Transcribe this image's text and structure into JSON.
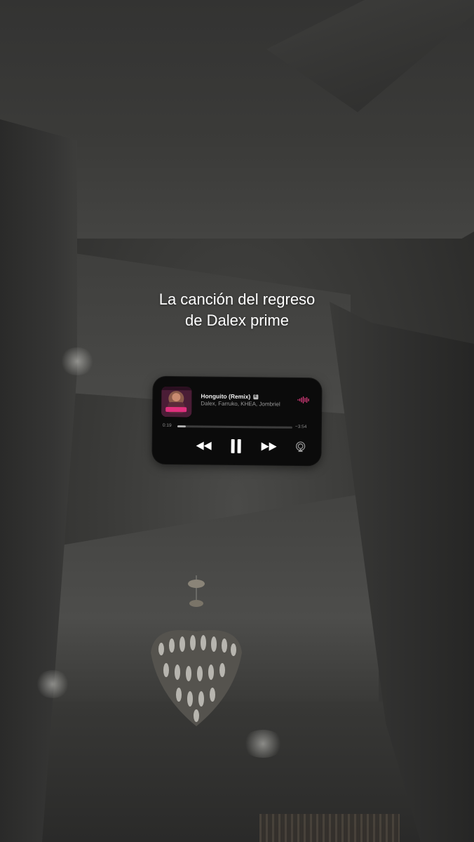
{
  "caption": {
    "line1": "La canción del regreso",
    "line2": "de Dalex prime"
  },
  "player": {
    "track_title": "Honguito (Remix)",
    "explicit_badge": "E",
    "artists": "Dalex, Farruko, KHEA, Jombriel",
    "time_elapsed": "0:19",
    "time_remaining": "−3:54",
    "progress_fraction": 0.075,
    "icons": {
      "album_art": "album-art",
      "waveform": "audio-waveform-icon",
      "rewind": "rewind-icon",
      "pause": "pause-icon",
      "fast_forward": "fast-forward-icon",
      "airplay": "airplay-icon"
    },
    "accent_color": "#d63a7a"
  }
}
